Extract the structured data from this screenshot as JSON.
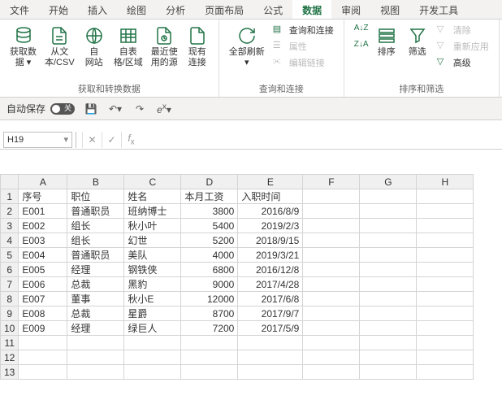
{
  "tabs": [
    "文件",
    "开始",
    "插入",
    "绘图",
    "分析",
    "页面布局",
    "公式",
    "数据",
    "审阅",
    "视图",
    "开发工具"
  ],
  "active_tab": "数据",
  "ribbon": {
    "group1_label": "获取和转换数据",
    "btn_getdata": "获取数\n据 ▾",
    "btn_fromcsv": "从文\n本/CSV",
    "btn_fromweb": "自\n网站",
    "btn_fromtable": "自表\n格/区域",
    "btn_recent": "最近使\n用的源",
    "btn_existing": "现有\n连接",
    "group2_label": "查询和连接",
    "btn_refreshall": "全部刷新\n▾",
    "btn_queries": "查询和连接",
    "btn_properties": "属性",
    "btn_editlinks": "编辑链接",
    "group3_label": "排序和筛选",
    "btn_sortasc": "A→Z",
    "btn_sortdesc": "Z→A",
    "btn_sort": "排序",
    "btn_filter": "筛选",
    "btn_clear": "清除",
    "btn_reapply": "重新应用",
    "btn_advanced": "高级"
  },
  "qat": {
    "autosave_label": "自动保存",
    "toggle_text": "关"
  },
  "namebox": "H19",
  "formula": "",
  "columns": [
    "A",
    "B",
    "C",
    "D",
    "E",
    "F",
    "G",
    "H"
  ],
  "headers": {
    "A": "序号",
    "B": "职位",
    "C": "姓名",
    "D": "本月工资",
    "E": "入职时间"
  },
  "rows": [
    {
      "A": "E001",
      "B": "普通职员",
      "C": "班纳博士",
      "D": "3800",
      "E": "2016/8/9"
    },
    {
      "A": "E002",
      "B": "组长",
      "C": "秋小叶",
      "D": "5400",
      "E": "2019/2/3"
    },
    {
      "A": "E003",
      "B": "组长",
      "C": "幻世",
      "D": "5200",
      "E": "2018/9/15"
    },
    {
      "A": "E004",
      "B": "普通职员",
      "C": "美队",
      "D": "4000",
      "E": "2019/3/21"
    },
    {
      "A": "E005",
      "B": "经理",
      "C": "钢铁侠",
      "D": "6800",
      "E": "2016/12/8"
    },
    {
      "A": "E006",
      "B": "总裁",
      "C": "黑豹",
      "D": "9000",
      "E": "2017/4/28"
    },
    {
      "A": "E007",
      "B": "董事",
      "C": "秋小E",
      "D": "12000",
      "E": "2017/6/8"
    },
    {
      "A": "E008",
      "B": "总裁",
      "C": "星爵",
      "D": "8700",
      "E": "2017/9/7"
    },
    {
      "A": "E009",
      "B": "经理",
      "C": "绿巨人",
      "D": "7200",
      "E": "2017/5/9"
    }
  ],
  "total_rows_shown": 13
}
